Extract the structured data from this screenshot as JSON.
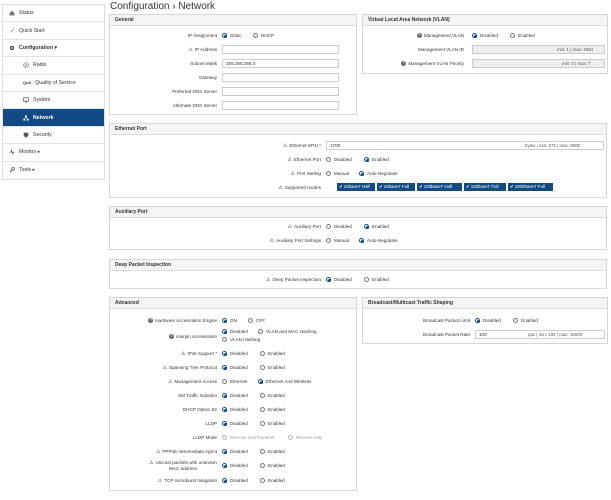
{
  "page_title": "Configuration  ›  Network",
  "sidebar": {
    "items": [
      {
        "label": "Status",
        "icon": "home-icon"
      },
      {
        "label": "Quick Start",
        "icon": "rocket-icon"
      },
      {
        "label": "Configuration ▾",
        "icon": "gear-icon"
      },
      {
        "label": "Radio",
        "icon": "wifi-icon"
      },
      {
        "label": "Quality of Service",
        "icon": "qos-icon"
      },
      {
        "label": "System",
        "icon": "monitor-icon"
      },
      {
        "label": "Network",
        "icon": "network-icon"
      },
      {
        "label": "Security",
        "icon": "shield-icon"
      },
      {
        "label": "Monitor ▸",
        "icon": "pulse-icon"
      },
      {
        "label": "Tools ▸",
        "icon": "wrench-icon"
      }
    ]
  },
  "general": {
    "title": "General",
    "ip_assignment": {
      "label": "IP Assignment",
      "options": [
        "Static",
        "DHCP"
      ],
      "selected": "Static"
    },
    "ip_address": {
      "label": "IP Address",
      "value": ""
    },
    "subnet_mask": {
      "label": "Subnet Mask",
      "value": "255.255.255.0"
    },
    "gateway": {
      "label": "Gateway",
      "value": ""
    },
    "preferred_dns": {
      "label": "Preferred DNS Server",
      "value": ""
    },
    "alternate_dns": {
      "label": "Alternate DNS Server",
      "value": ""
    }
  },
  "vlan": {
    "title": "Virtual Local Area Network (VLAN)",
    "mgmt_vlan": {
      "label": "Management VLAN",
      "options": [
        "Disabled",
        "Enabled"
      ],
      "selected": "Disabled"
    },
    "mgmt_vlan_id": {
      "label": "Management VLAN ID",
      "value": "",
      "hint": "min: 1 | max: 4094"
    },
    "mgmt_vlan_priority": {
      "label": "Management VLAN Priority",
      "value": "",
      "hint": "min: 0 | max: 7"
    }
  },
  "ethernet": {
    "title": "Ethernet Port",
    "mtu": {
      "label": "Ethernet MTU",
      "required": "*",
      "value": "1700",
      "hint": "bytes | min: 576 | max: 9600"
    },
    "port": {
      "label": "Ethernet Port",
      "options": [
        "Disabled",
        "Enabled"
      ],
      "selected": "Enabled"
    },
    "port_setting": {
      "label": "Port Setting",
      "options": [
        "Manual",
        "Auto-Negotiate"
      ],
      "selected": "Auto-Negotiate"
    },
    "modes": {
      "label": "Supported modes",
      "values": [
        "10baseT Half",
        "10baseT Full",
        "100baseT Half",
        "100baseT Full",
        "1000baseT Full"
      ]
    }
  },
  "aux": {
    "title": "Auxiliary Port",
    "port": {
      "label": "Auxiliary Port",
      "options": [
        "Disabled",
        "Enabled"
      ],
      "selected": "Enabled"
    },
    "settings": {
      "label": "Auxiliary Port Settings",
      "options": [
        "Manual",
        "Auto-Negotiate"
      ],
      "selected": "Auto-Negotiate"
    }
  },
  "dpi": {
    "title": "Deep Packet Inspection",
    "field": {
      "label": "Deep Packet Inspection",
      "options": [
        "Disabled",
        "Enabled"
      ],
      "selected": "Disabled"
    }
  },
  "advanced": {
    "title": "Advanced",
    "rows": [
      {
        "label": "Hardware Acceleration Engine",
        "options": [
          "ON",
          "OFF"
        ],
        "selected": "ON"
      },
      {
        "label": "Hairpin Acceleration",
        "options": [
          "Disabled",
          "VLAN and MAC Hashing",
          "VLAN Hashing"
        ],
        "selected": "Disabled"
      },
      {
        "label": "IPv6 Support",
        "required": "*",
        "options": [
          "Disabled",
          "Enabled"
        ],
        "selected": "Disabled"
      },
      {
        "label": "Spanning Tree Protocol",
        "options": [
          "Disabled",
          "Enabled"
        ],
        "selected": "Disabled"
      },
      {
        "label": "Management Access",
        "options": [
          "Ethernet",
          "Ethernet And Wireless"
        ],
        "selected": "Ethernet And Wireless"
      },
      {
        "label": "SM Traffic Isolation",
        "options": [
          "Disabled",
          "Enabled"
        ],
        "selected": "Disabled"
      },
      {
        "label": "DHCP Option 82",
        "options": [
          "Disabled",
          "Enabled"
        ],
        "selected": "Disabled"
      },
      {
        "label": "LLDP",
        "options": [
          "Disabled",
          "Enabled"
        ],
        "selected": "Disabled"
      },
      {
        "label": "LLDP Mode",
        "options": [
          "Receive and Transmit",
          "Receive only"
        ],
        "selected": "Receive and Transmit",
        "disabled": true
      },
      {
        "label": "PPPoE Intermediate Agent",
        "options": [
          "Disabled",
          "Enabled"
        ],
        "selected": "Disabled"
      },
      {
        "label": "Unicast packets with unknown",
        "label2": "MAC address",
        "options": [
          "Disabled",
          "Enabled"
        ],
        "selected": "Disabled"
      },
      {
        "label": "TCP microburst mitigation",
        "options": [
          "Disabled",
          "Enabled"
        ],
        "selected": "Disabled"
      }
    ]
  },
  "broadcast": {
    "title": "Broadcast/Multicast Traffic Shaping",
    "limit": {
      "label": "Broadcast Packet Limit",
      "options": [
        "Disabled",
        "Enabled"
      ],
      "selected": "Disabled"
    },
    "rate": {
      "label": "Broadcast Packet Rate",
      "value": "100",
      "hint": "pps | min: 100 | max: 16000"
    }
  },
  "colors": {
    "accent": "#134a84",
    "panel_header": "#f4f4f4",
    "border": "#d6d6d6"
  }
}
